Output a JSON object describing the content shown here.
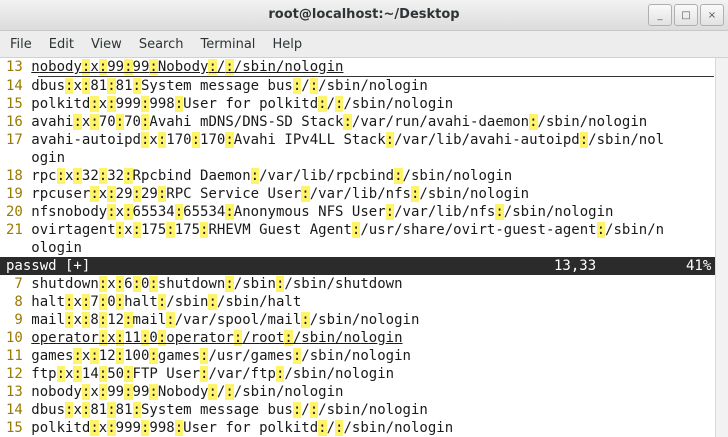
{
  "window": {
    "title": "root@localhost:~/Desktop"
  },
  "window_buttons": [
    "_",
    "□",
    "×"
  ],
  "menu": [
    "File",
    "Edit",
    "View",
    "Search",
    "Terminal",
    "Help"
  ],
  "top_pane": [
    {
      "ln": "13",
      "t": "nobody:x:99:99:Nobody:/:/sbin/nologin",
      "underline": true
    },
    {
      "ln": "14",
      "t": "dbus:x:81:81:System message bus:/:/sbin/nologin"
    },
    {
      "ln": "15",
      "t": "polkitd:x:999:998:User for polkitd:/:/sbin/nologin"
    },
    {
      "ln": "16",
      "t": "avahi:x:70:70:Avahi mDNS/DNS-SD Stack:/var/run/avahi-daemon:/sbin/nologin"
    },
    {
      "ln": "17",
      "t": "avahi-autoipd:x:170:170:Avahi IPv4LL Stack:/var/lib/avahi-autoipd:/sbin/nol",
      "wrap": "ogin"
    },
    {
      "ln": "18",
      "t": "rpc:x:32:32:Rpcbind Daemon:/var/lib/rpcbind:/sbin/nologin"
    },
    {
      "ln": "19",
      "t": "rpcuser:x:29:29:RPC Service User:/var/lib/nfs:/sbin/nologin"
    },
    {
      "ln": "20",
      "t": "nfsnobody:x:65534:65534:Anonymous NFS User:/var/lib/nfs:/sbin/nologin"
    },
    {
      "ln": "21",
      "t": "ovirtagent:x:175:175:RHEVM Guest Agent:/usr/share/ovirt-guest-agent:/sbin/n",
      "wrap": "ologin"
    }
  ],
  "status": {
    "file": "passwd [+]",
    "pos": "13,33",
    "pct": "41%"
  },
  "bottom_pane": [
    {
      "ln": "7",
      "t": "shutdown:x:6:0:shutdown:/sbin:/sbin/shutdown"
    },
    {
      "ln": "8",
      "t": "halt:x:7:0:halt:/sbin:/sbin/halt"
    },
    {
      "ln": "9",
      "t": "mail:x:8:12:mail:/var/spool/mail:/sbin/nologin"
    },
    {
      "ln": "10",
      "t": "operator:x:11:0:operator:/root:/sbin/nologin",
      "underline": true
    },
    {
      "ln": "11",
      "t": "games:x:12:100:games:/usr/games:/sbin/nologin"
    },
    {
      "ln": "12",
      "t": "ftp:x:14:50:FTP User:/var/ftp:/sbin/nologin"
    },
    {
      "ln": "13",
      "t": "nobody:x:99:99:Nobody:/:/sbin/nologin"
    },
    {
      "ln": "14",
      "t": "dbus:x:81:81:System message bus:/:/sbin/nologin"
    },
    {
      "ln": "15",
      "t": "polkitd:x:999:998:User for polkitd:/:/sbin/nologin"
    }
  ]
}
